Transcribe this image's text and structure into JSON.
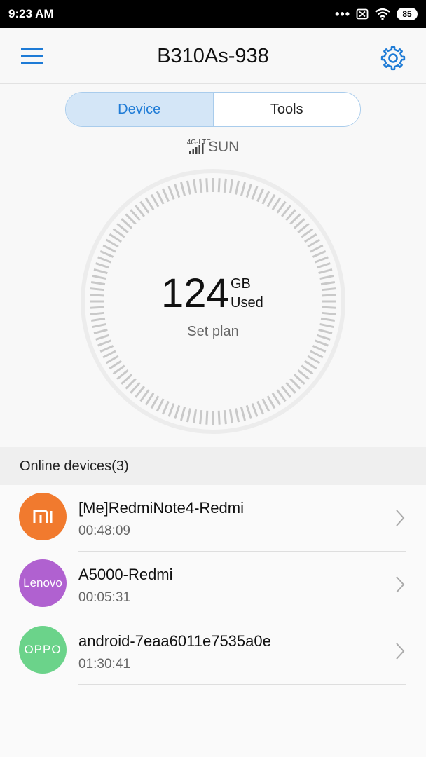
{
  "status_bar": {
    "time": "9:23 AM",
    "battery": "85"
  },
  "header": {
    "title": "B310As-938",
    "menu_icon": "hamburger-menu-icon",
    "settings_icon": "gear-icon"
  },
  "tabs": [
    {
      "label": "Device",
      "active": true
    },
    {
      "label": "Tools",
      "active": false
    }
  ],
  "network": {
    "type": "4G-LTE",
    "carrier": "SUN"
  },
  "usage": {
    "value": "124",
    "unit": "GB",
    "used_label": "Used",
    "set_plan": "Set plan"
  },
  "online_devices": {
    "title": "Online devices(3)",
    "items": [
      {
        "name": "[Me]RedmiNote4-Redmi",
        "duration": "00:48:09",
        "brand": "MI",
        "color": "#f17a2e"
      },
      {
        "name": "A5000-Redmi",
        "duration": "00:05:31",
        "brand": "Lenovo",
        "color": "#b061d0"
      },
      {
        "name": "android-7eaa6011e7535a0e",
        "duration": "01:30:41",
        "brand": "OPPO",
        "color": "#6bd38a"
      }
    ]
  },
  "colors": {
    "accent": "#1e7bd6",
    "tab_active_bg": "#d4e6f7"
  }
}
